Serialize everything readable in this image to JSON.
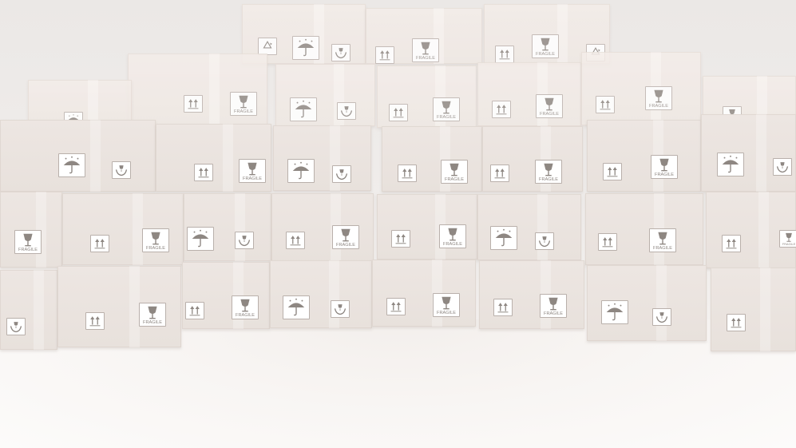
{
  "scene": {
    "description_free": true,
    "label_text": "FRAGILE",
    "colors": {
      "background": "#ece9e7",
      "box": "#e9e2dd",
      "floor": "#faf8f7",
      "label_ink": "#8e8782"
    },
    "icons": [
      "fragile-glass-icon",
      "this-side-up-icon",
      "keep-dry-umbrella-icon",
      "handle-with-care-icon",
      "recycle-icon"
    ]
  }
}
